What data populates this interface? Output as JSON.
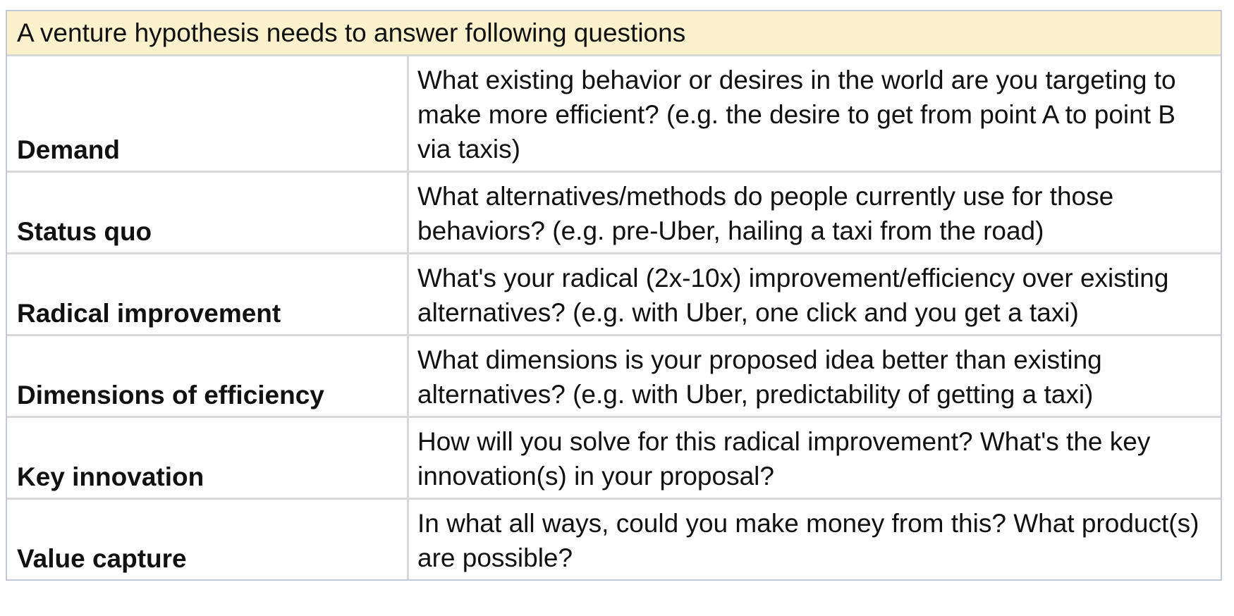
{
  "title": "A venture hypothesis needs to answer following questions",
  "rows": [
    {
      "label": "Demand",
      "text": "What existing behavior or desires in the world are you targeting to make more efficient? (e.g. the desire to get from point A to point B via taxis)"
    },
    {
      "label": "Status quo",
      "text": "What alternatives/methods do people currently use for those behaviors? (e.g. pre-Uber, hailing a taxi from the road)"
    },
    {
      "label": "Radical improvement",
      "text": "What's your radical (2x-10x) improvement/efficiency over existing alternatives? (e.g. with Uber, one click and you get a taxi)"
    },
    {
      "label": "Dimensions of efficiency",
      "text": "What dimensions is your proposed idea better than existing alternatives? (e.g. with Uber, predictability of getting a taxi)"
    },
    {
      "label": "Key innovation",
      "text": "How will you solve for this radical improvement? What's the key innovation(s) in your proposal?"
    },
    {
      "label": "Value capture",
      "text": "In what all ways, could you make money from this? What product(s) are possible?"
    }
  ]
}
